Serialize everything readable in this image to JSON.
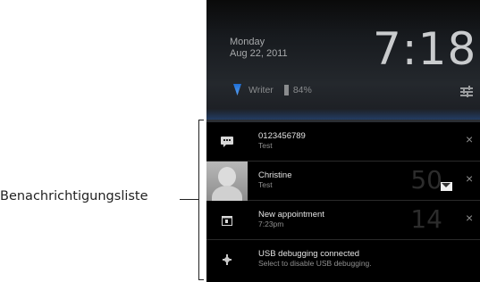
{
  "annotation": {
    "label": "Benachrichtigungsliste"
  },
  "header": {
    "day": "Monday",
    "date": "Aug 22, 2011",
    "time": "7:18",
    "network": "Writer",
    "battery": "84%"
  },
  "notifications": [
    {
      "icon": "sms-icon",
      "title": "0123456789",
      "subtitle": "Test",
      "count": "",
      "close": "×"
    },
    {
      "icon": "contact-avatar",
      "title": "Christine",
      "subtitle": "Test",
      "count": "50",
      "badge_icon": "mail-icon",
      "close": "×"
    },
    {
      "icon": "calendar-icon",
      "title": "New appointment",
      "subtitle": "7:23pm",
      "count": "14",
      "close": "×"
    },
    {
      "icon": "usb-icon",
      "title": "USB debugging connected",
      "subtitle": "Select to disable USB debugging.",
      "count": "",
      "close": ""
    }
  ],
  "colors": {
    "background": "#000000",
    "accent_blue": "#1e6fd6",
    "text_primary": "#e4e4e4",
    "text_secondary": "#8f8f8f"
  }
}
